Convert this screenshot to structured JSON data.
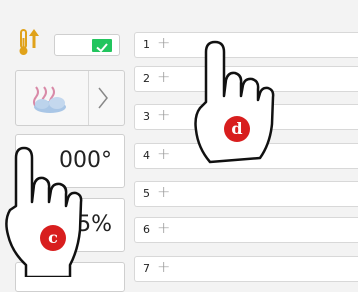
{
  "left_panel": {
    "temp_icon": "thermometer-arrow-up-icon",
    "check_icon": "checkmark-icon",
    "steam_icon": "steam-humidity-icon",
    "chevron_icon": "chevron-right-icon",
    "temperature_value": "000°",
    "humidity_value": "5%"
  },
  "step_rows": [
    {
      "num": "1",
      "plus": "+"
    },
    {
      "num": "2",
      "plus": "+"
    },
    {
      "num": "3",
      "plus": "+"
    },
    {
      "num": "4",
      "plus": "+"
    },
    {
      "num": "5",
      "plus": "+"
    },
    {
      "num": "6",
      "plus": "+"
    },
    {
      "num": "7",
      "plus": "+"
    }
  ],
  "overlays": {
    "hand_c_label": "c",
    "hand_d_label": "d"
  },
  "colors": {
    "check_green": "#22c55e",
    "marker_red": "#d81e1e",
    "thermo_gold": "#e0a21a"
  }
}
